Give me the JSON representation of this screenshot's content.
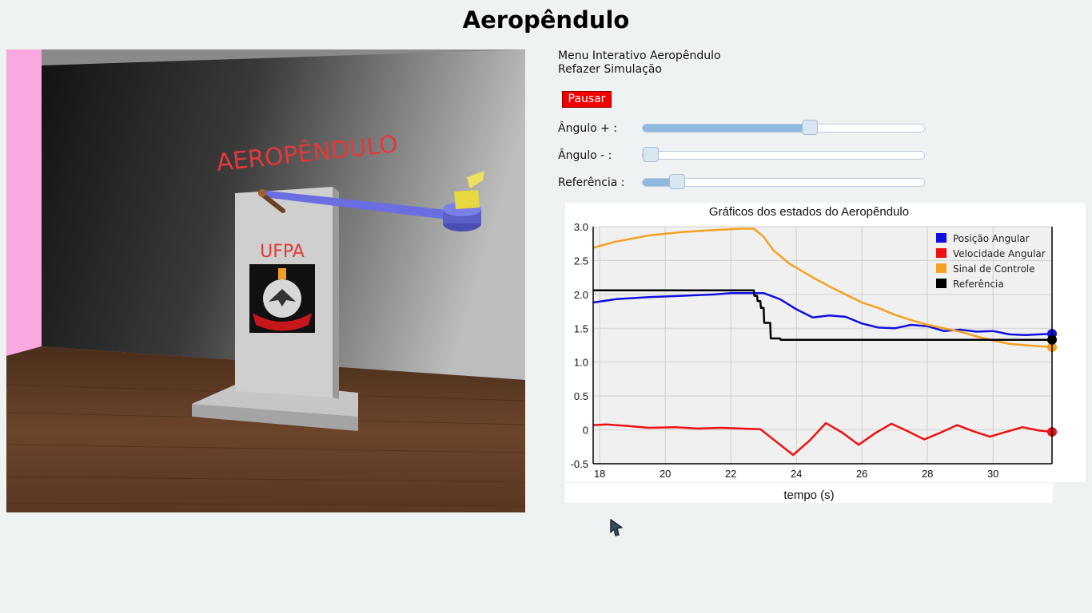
{
  "page": {
    "title": "Aeropêndulo"
  },
  "scene": {
    "wall_text": "AEROPÊNDULO",
    "stand_text": "UFPA",
    "colors": {
      "rod": "#6a6ee0",
      "wall_text": "#e23a3a",
      "side_wall": "#f9a8e0",
      "floor": "#5a3520"
    }
  },
  "menu": {
    "interactive_menu": "Menu Interativo Aeropêndulo",
    "redo_simulation": "Refazer Simulação",
    "pause_button": "Pausar"
  },
  "sliders": [
    {
      "label": "Ângulo +  :",
      "value_fraction": 0.6
    },
    {
      "label": "Ângulo -   :",
      "value_fraction": 0.0
    },
    {
      "label": "Referência :",
      "value_fraction": 0.1
    }
  ],
  "chart_data": {
    "type": "line",
    "title": "Gráficos dos estados do Aeropêndulo",
    "xlabel": "tempo (s)",
    "ylabel": "",
    "xlim": [
      17.8,
      31.8
    ],
    "ylim": [
      -0.5,
      3.0
    ],
    "xticks": [
      "18",
      "20",
      "22",
      "24",
      "26",
      "28",
      "30"
    ],
    "yticks": [
      "3.0",
      "2.5",
      "2.0",
      "1.5",
      "1.0",
      "0.5",
      "0",
      "-0.5"
    ],
    "grid": true,
    "legend_position": "top-right",
    "series": [
      {
        "name": "Posição Angular",
        "color": "#1010e0",
        "x": [
          17.8,
          18.5,
          19.5,
          20.5,
          21.5,
          22.0,
          22.5,
          23.0,
          23.5,
          24.0,
          24.5,
          25.0,
          25.5,
          26.0,
          26.5,
          27.0,
          27.5,
          28.0,
          28.5,
          29.0,
          29.5,
          30.0,
          30.5,
          31.0,
          31.8
        ],
        "y": [
          1.88,
          1.93,
          1.96,
          1.98,
          2.0,
          2.02,
          2.02,
          2.02,
          1.93,
          1.78,
          1.66,
          1.69,
          1.67,
          1.57,
          1.51,
          1.5,
          1.55,
          1.53,
          1.46,
          1.48,
          1.45,
          1.46,
          1.41,
          1.4,
          1.42
        ]
      },
      {
        "name": "Velocidade Angular",
        "color": "#ee1010",
        "x": [
          17.8,
          18.2,
          18.8,
          19.5,
          20.3,
          21.0,
          21.7,
          22.3,
          22.9,
          23.4,
          23.9,
          24.4,
          24.9,
          25.4,
          25.9,
          26.4,
          26.9,
          27.4,
          27.9,
          28.4,
          28.9,
          29.4,
          29.9,
          30.4,
          30.9,
          31.4,
          31.8
        ],
        "y": [
          0.07,
          0.08,
          0.06,
          0.03,
          0.04,
          0.02,
          0.03,
          0.02,
          0.01,
          -0.18,
          -0.37,
          -0.16,
          0.1,
          -0.04,
          -0.22,
          -0.05,
          0.09,
          -0.02,
          -0.14,
          -0.04,
          0.07,
          -0.02,
          -0.1,
          -0.03,
          0.04,
          -0.01,
          -0.03
        ]
      },
      {
        "name": "Sinal de Controle",
        "color": "#f5a020",
        "x": [
          17.8,
          18.5,
          19.5,
          20.5,
          21.5,
          22.3,
          22.7,
          23.0,
          23.3,
          23.8,
          24.5,
          25.0,
          25.5,
          26.0,
          26.5,
          27.0,
          27.5,
          28.0,
          28.5,
          29.0,
          29.5,
          30.0,
          30.5,
          31.0,
          31.8
        ],
        "y": [
          2.69,
          2.78,
          2.87,
          2.92,
          2.95,
          2.97,
          2.97,
          2.85,
          2.65,
          2.45,
          2.25,
          2.12,
          2.0,
          1.88,
          1.8,
          1.7,
          1.62,
          1.55,
          1.5,
          1.45,
          1.38,
          1.32,
          1.27,
          1.25,
          1.22
        ]
      },
      {
        "name": "Referência",
        "color": "#000000",
        "x": [
          17.8,
          22.7,
          22.72,
          22.8,
          22.82,
          22.9,
          22.92,
          23.0,
          23.02,
          23.2,
          23.22,
          23.5,
          23.52,
          31.8
        ],
        "y": [
          2.06,
          2.06,
          1.98,
          1.98,
          1.9,
          1.9,
          1.8,
          1.8,
          1.58,
          1.58,
          1.35,
          1.35,
          1.33,
          1.33
        ]
      }
    ]
  }
}
